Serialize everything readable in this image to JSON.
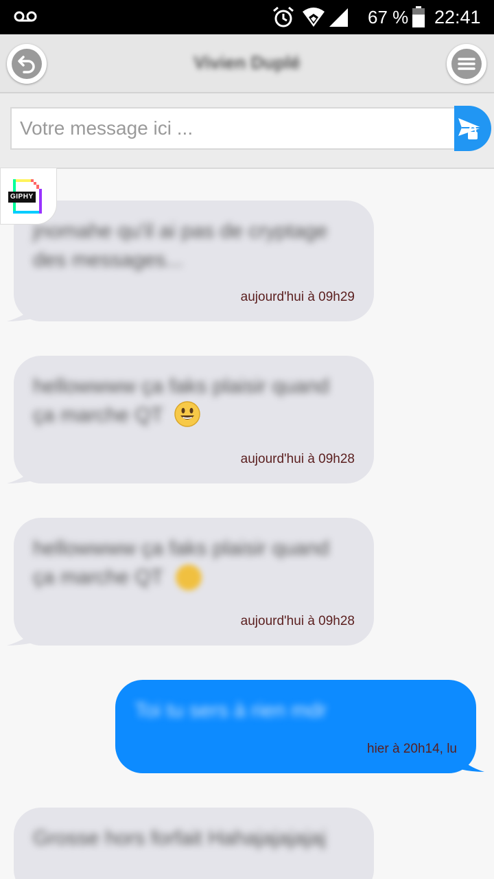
{
  "status_bar": {
    "battery_percent": "67 %",
    "battery_level": 0.67,
    "time": "22:41",
    "icons": [
      "voicemail-icon",
      "alarm-icon",
      "wifi-icon",
      "signal-icon",
      "battery-icon"
    ]
  },
  "header": {
    "contact_name": "Vivien Duplé",
    "back_icon": "undo-arrow-icon",
    "menu_icon": "hamburger-menu-icon"
  },
  "composer": {
    "placeholder": "Votre message ici ...",
    "value": "",
    "send_icon": "paper-plane-lock-icon"
  },
  "giphy": {
    "label": "GIPHY"
  },
  "messages": [
    {
      "direction": "incoming",
      "text": "jnomahe qu'il ai pas de cryptage des messages...",
      "time": "aujourd'hui à 09h29"
    },
    {
      "direction": "incoming",
      "text": "hellowwww ça faks plaisir quand ça marche QT",
      "emoji": "smiley-emoji",
      "time": "aujourd'hui à 09h28"
    },
    {
      "direction": "incoming",
      "text": "hellowwww ça faks plaisir quand ça marche QT",
      "emoji": "smiley-emoji",
      "time": "aujourd'hui à 09h28"
    },
    {
      "direction": "outgoing",
      "text": "Toi tu sers à rien mdr",
      "time": "hier à 20h14, lu"
    },
    {
      "direction": "incoming",
      "text": "Grosse hors forfait Hahajajajajaj",
      "time": ""
    }
  ],
  "colors": {
    "incoming_bubble": "#e4e4ea",
    "outgoing_bubble": "#0d8bff",
    "send_button": "#2196f3",
    "timestamp": "#5a1e1e"
  }
}
